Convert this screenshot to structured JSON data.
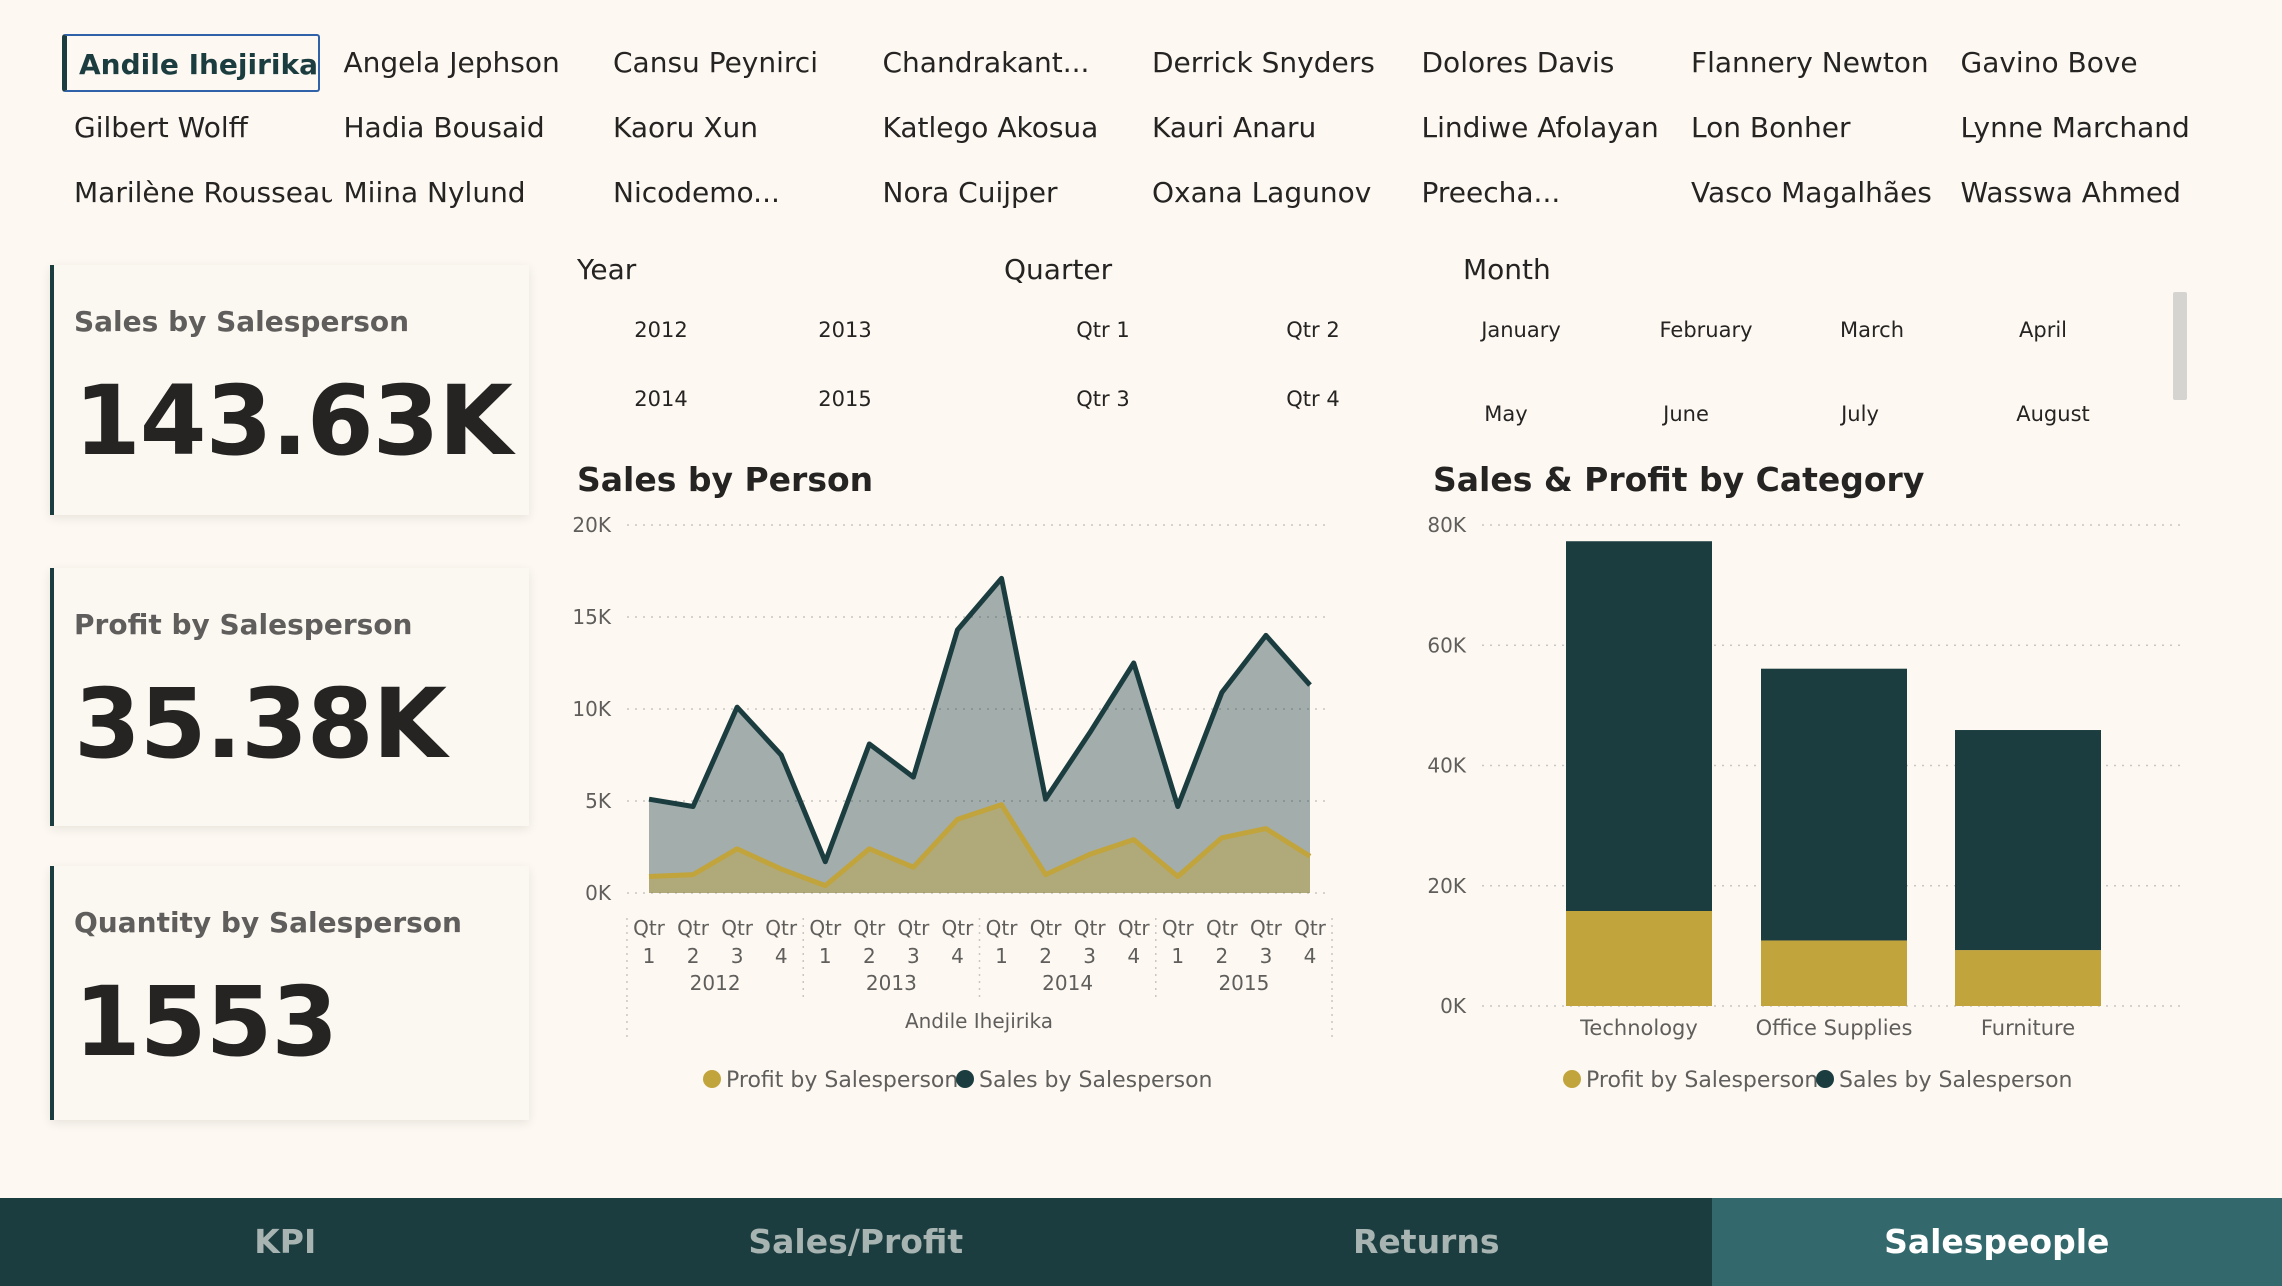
{
  "people": [
    "Andile Ihejirika",
    "Angela Jephson",
    "Cansu Peynirci",
    "Chandrakant...",
    "Derrick Snyders",
    "Dolores Davis",
    "Flannery Newton",
    "Gavino Bove",
    "Gilbert Wolff",
    "Hadia Bousaid",
    "Kaoru Xun",
    "Katlego Akosua",
    "Kauri Anaru",
    "Lindiwe Afolayan",
    "Lon Bonher",
    "Lynne Marchand",
    "Marilène Rousseau",
    "Miina Nylund",
    "Nicodemo...",
    "Nora Cuijper",
    "Oxana Lagunov",
    "Preecha...",
    "Vasco Magalhães",
    "Wasswa Ahmed"
  ],
  "kpis": {
    "sales": {
      "title": "Sales by Salesperson",
      "value": "143.63K"
    },
    "profit": {
      "title": "Profit by Salesperson",
      "value": "35.38K"
    },
    "quantity": {
      "title": "Quantity by Salesperson",
      "value": "1553"
    }
  },
  "slicers": {
    "year": {
      "title": "Year",
      "items": [
        "2012",
        "2013",
        "2014",
        "2015"
      ]
    },
    "quarter": {
      "title": "Quarter",
      "items": [
        "Qtr 1",
        "Qtr 2",
        "Qtr 3",
        "Qtr 4"
      ]
    },
    "month": {
      "title": "Month",
      "items": [
        "January",
        "February",
        "March",
        "April",
        "May",
        "June",
        "July",
        "August"
      ]
    }
  },
  "chart_data": [
    {
      "type": "area",
      "title": "Sales by Person",
      "y_ticks": [
        "0K",
        "5K",
        "10K",
        "15K",
        "20K"
      ],
      "ylim": [
        0,
        20000
      ],
      "x_quarter_labels": [
        "Qtr",
        "1",
        "Qtr",
        "2",
        "Qtr",
        "3",
        "Qtr",
        "4"
      ],
      "years": [
        "2012",
        "2013",
        "2014",
        "2015"
      ],
      "group_label": "Andile Ihejirika",
      "series": [
        {
          "name": "Sales by Salesperson",
          "color": "#1b3d40",
          "values": [
            5100,
            4700,
            10100,
            7500,
            1700,
            8100,
            6300,
            14300,
            17100,
            5100,
            8700,
            12500,
            4700,
            10900,
            14000,
            11300
          ]
        },
        {
          "name": "Profit by Salesperson",
          "color": "#c2a43d",
          "values": [
            900,
            1000,
            2400,
            1300,
            400,
            2400,
            1400,
            4000,
            4800,
            1000,
            2100,
            2900,
            900,
            3000,
            3500,
            2000
          ]
        }
      ]
    },
    {
      "type": "bar",
      "stacked": true,
      "title": "Sales & Profit by Category",
      "categories": [
        "Technology",
        "Office Supplies",
        "Furniture"
      ],
      "y_ticks": [
        "0K",
        "20K",
        "40K",
        "60K",
        "80K"
      ],
      "ylim": [
        0,
        80000
      ],
      "series": [
        {
          "name": "Profit by Salesperson",
          "color": "#c2a43d",
          "values": [
            15800,
            10900,
            9300
          ]
        },
        {
          "name": "Sales by Salesperson",
          "color": "#1b3d40",
          "values": [
            61500,
            45200,
            36600
          ]
        }
      ]
    }
  ],
  "tabs": [
    {
      "label": "KPI",
      "active": false
    },
    {
      "label": "Sales/Profit",
      "active": false
    },
    {
      "label": "Returns",
      "active": false
    },
    {
      "label": "Salespeople",
      "active": true
    }
  ],
  "colors": {
    "dark_teal": "#1b3d40",
    "gold": "#c2a43d",
    "active_tab": "#33686d",
    "background": "#fdf9f2"
  }
}
